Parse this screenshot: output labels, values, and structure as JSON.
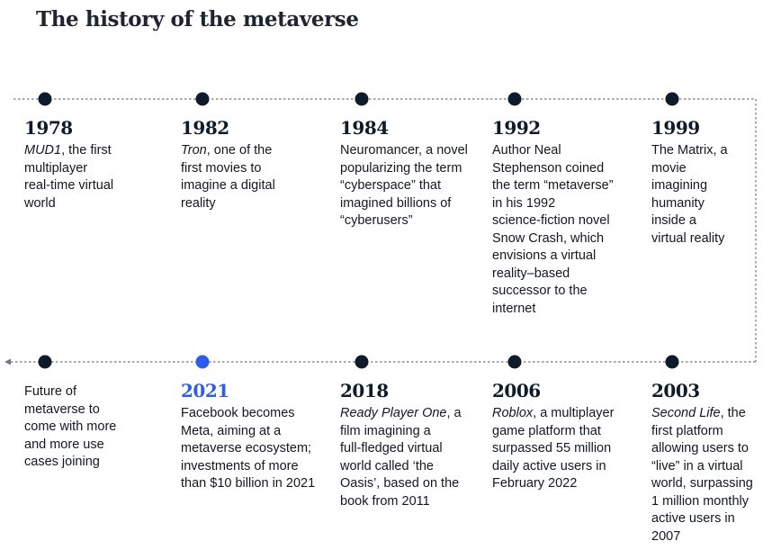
{
  "title": "The history of the metaverse",
  "colors": {
    "line": "#6f7780",
    "dot": "#0d1b2a",
    "accent": "#2f5ce8"
  },
  "top_row": [
    {
      "year": "1978",
      "lead": "MUD1",
      "lead_italic": true,
      "text": ", the first\nmultiplayer\nreal-time virtual\nworld"
    },
    {
      "year": "1982",
      "lead": "Tron",
      "lead_italic": true,
      "text": ", one of the\nfirst movies to\nimagine a digital\nreality"
    },
    {
      "year": "1984",
      "lead": "",
      "lead_italic": false,
      "text": "Neuromancer, a novel\npopularizing the term\n“cyberspace” that\nimagined billions of\n“cyberusers”"
    },
    {
      "year": "1992",
      "lead": "",
      "lead_italic": false,
      "text": "Author Neal\nStephenson coined\nthe term “metaverse”\nin his 1992\nscience-fiction novel\nSnow Crash, which\nenvisions a virtual\nreality–based\nsuccessor to the\ninternet"
    },
    {
      "year": "1999",
      "lead": "",
      "lead_italic": false,
      "text": "The Matrix, a\nmovie\nimagining\nhumanity\ninside a\nvirtual reality"
    }
  ],
  "bottom_row": [
    {
      "year": "",
      "accent": false,
      "lead": "",
      "lead_italic": false,
      "text": "Future of\nmetaverse to\ncome with more\nand more use\ncases joining"
    },
    {
      "year": "2021",
      "accent": true,
      "lead": "",
      "lead_italic": false,
      "text": "Facebook becomes\nMeta, aiming at a\nmetaverse ecosystem;\ninvestments of more\nthan $10 billion in 2021"
    },
    {
      "year": "2018",
      "accent": false,
      "lead": "Ready Player One",
      "lead_italic": true,
      "text": ", a\nfilm imagining a\nfull-fledged virtual\nworld called ‘the\nOasis’, based on the\nbook from 2011"
    },
    {
      "year": "2006",
      "accent": false,
      "lead": "Roblox",
      "lead_italic": true,
      "text": ", a multiplayer\ngame platform that\nsurpassed 55 million\ndaily active users in\nFebruary 2022"
    },
    {
      "year": "2003",
      "accent": false,
      "lead": "Second Life",
      "lead_italic": true,
      "text": ", the\nfirst platform\nallowing users to\n“live” in a virtual\nworld, surpassing\n1 million monthly\nactive users in\n2007"
    }
  ]
}
